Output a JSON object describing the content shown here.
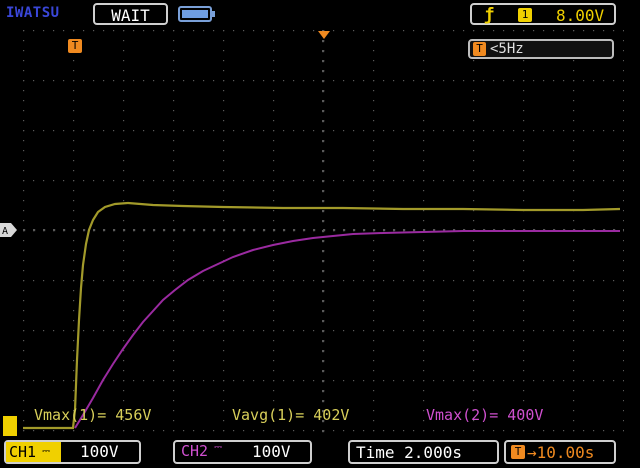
{
  "header": {
    "brand": "IWATSU",
    "status": "WAIT",
    "trigger": {
      "channel": "1",
      "level": "8.00V",
      "slope": "rising"
    }
  },
  "display": {
    "trigger_position_marker": "T",
    "frequency_readout": "<5Hz",
    "ground_marker": "A"
  },
  "measurements": [
    {
      "label": "Vmax(1)= 456V",
      "color": "#d8cf5a"
    },
    {
      "label": "Vavg(1)= 402V",
      "color": "#d8cf5a"
    },
    {
      "label": "Vmax(2)= 400V",
      "color": "#d050d0"
    }
  ],
  "footer": {
    "ch1": {
      "label": "CH1",
      "coupling": "DC",
      "scale": "100V"
    },
    "ch2": {
      "label": "CH2",
      "coupling": "DC",
      "scale": "100V"
    },
    "time": "Time 2.000s",
    "delay": "10.00s"
  },
  "colors": {
    "ch1": "#d8cf5a",
    "ch1_trace": "#a29a2a",
    "ch2": "#d050d0",
    "ch2_trace": "#9a2aa0",
    "trigger_marker": "#f08a20",
    "accent": "#f0d000"
  },
  "icons": [
    "battery-icon",
    "rising-edge-icon",
    "trigger-marker-icon",
    "ground-marker-icon"
  ]
}
